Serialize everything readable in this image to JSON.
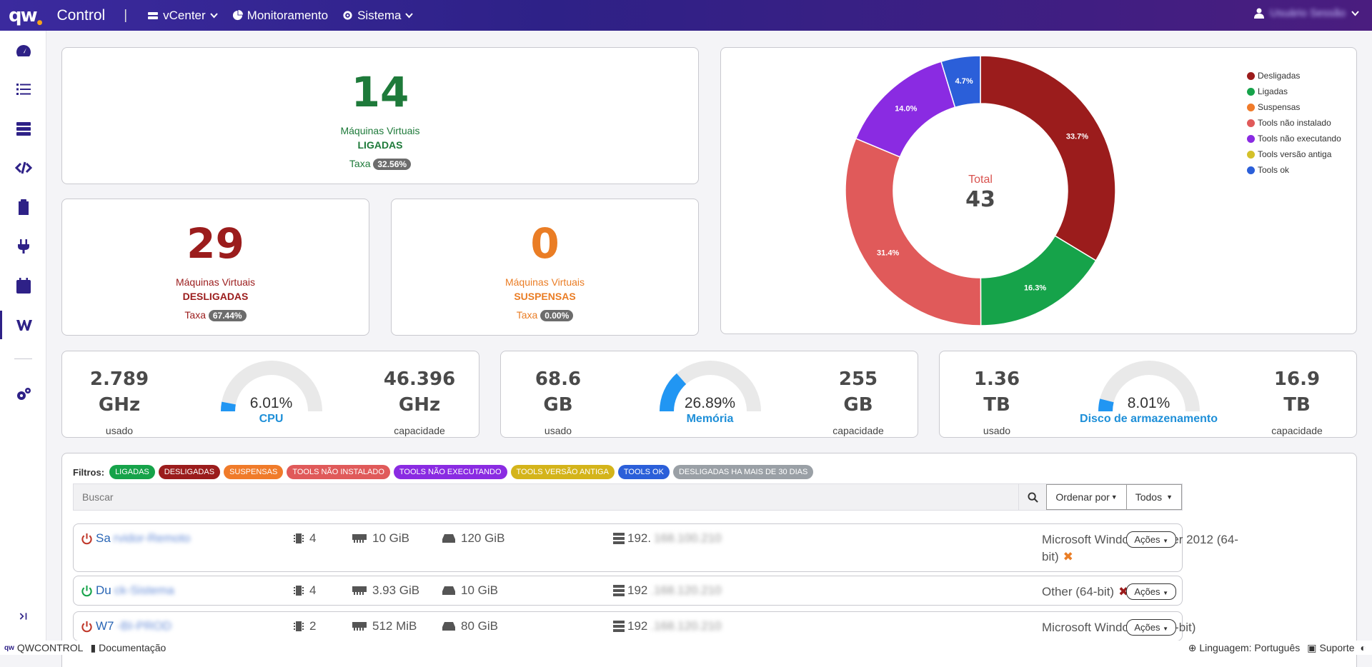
{
  "header": {
    "app_title": "Control",
    "vcenter": "vCenter",
    "monitoramento": "Monitoramento",
    "sistema": "Sistema",
    "user": "Usuário Sessão"
  },
  "stats": {
    "ligadas": {
      "value": "14",
      "label1": "Máquinas Virtuais",
      "label2": "LIGADAS",
      "taxa_label": "Taxa",
      "taxa": "32.56%",
      "color": "#1e7a3a"
    },
    "desligadas": {
      "value": "29",
      "label1": "Máquinas Virtuais",
      "label2": "DESLIGADAS",
      "taxa_label": "Taxa",
      "taxa": "67.44%",
      "color": "#9b1c1c"
    },
    "suspensas": {
      "value": "0",
      "label1": "Máquinas Virtuais",
      "label2": "SUSPENSAS",
      "taxa_label": "Taxa",
      "taxa": "0.00%",
      "color": "#ea7d25"
    }
  },
  "chart_data": {
    "type": "pie",
    "center_label": "Total",
    "center_value": "43",
    "slices": [
      {
        "name": "Desligadas",
        "value": 33.7,
        "label": "33.7%",
        "color": "#9b1c1c"
      },
      {
        "name": "Ligadas",
        "value": 16.3,
        "label": "16.3%",
        "color": "#16a34a"
      },
      {
        "name": "Tools não instalado",
        "value": 31.4,
        "label": "31.4%",
        "color": "#e05a5a"
      },
      {
        "name": "Tools não executando",
        "value": 14.0,
        "label": "14.0%",
        "color": "#8a2be2"
      },
      {
        "name": "Tools ok",
        "value": 4.7,
        "label": "4.7%",
        "color": "#2b5fd9"
      }
    ],
    "legend": [
      {
        "name": "Desligadas",
        "color": "#9b1c1c"
      },
      {
        "name": "Ligadas",
        "color": "#16a34a"
      },
      {
        "name": "Suspensas",
        "color": "#f07b2a"
      },
      {
        "name": "Tools não instalado",
        "color": "#e05a5a"
      },
      {
        "name": "Tools não executando",
        "color": "#8a2be2"
      },
      {
        "name": "Tools versão antiga",
        "color": "#d4c12a"
      },
      {
        "name": "Tools ok",
        "color": "#2b5fd9"
      }
    ],
    "legend_position": "top-right"
  },
  "gauges": [
    {
      "used_num": "2.789",
      "used_unit": "GHz",
      "used_label": "usado",
      "pct": "6.01%",
      "pct_value": 6.01,
      "name": "CPU",
      "cap_num": "46.396",
      "cap_unit": "GHz",
      "cap_label": "capacidade"
    },
    {
      "used_num": "68.6",
      "used_unit": "GB",
      "used_label": "usado",
      "pct": "26.89%",
      "pct_value": 26.89,
      "name": "Memória",
      "cap_num": "255",
      "cap_unit": "GB",
      "cap_label": "capacidade"
    },
    {
      "used_num": "1.36",
      "used_unit": "TB",
      "used_label": "usado",
      "pct": "8.01%",
      "pct_value": 8.01,
      "name": "Disco de armazenamento",
      "cap_num": "16.9",
      "cap_unit": "TB",
      "cap_label": "capacidade"
    }
  ],
  "filters": {
    "label": "Filtros:",
    "items": [
      {
        "label": "Ligadas",
        "color": "#16a34a"
      },
      {
        "label": "Desligadas",
        "color": "#9b1c1c"
      },
      {
        "label": "Suspensas",
        "color": "#f07b2a"
      },
      {
        "label": "Tools não instalado",
        "color": "#e05a5a"
      },
      {
        "label": "Tools não executando",
        "color": "#8a2be2"
      },
      {
        "label": "Tools versão antiga",
        "color": "#d4b41a"
      },
      {
        "label": "Tools ok",
        "color": "#2b5fd9"
      },
      {
        "label": "Desligadas ha mais de 30 dias",
        "color": "#9aa0a6"
      }
    ]
  },
  "search": {
    "placeholder": "Buscar",
    "order_label": "Ordenar por",
    "all_label": "Todos"
  },
  "vms": [
    {
      "name_prefix": "Sa",
      "name_rest": "rvidor-Remoto",
      "status": "off",
      "cpus": "4",
      "ram": "10 GiB",
      "disk": "120 GiB",
      "ip_prefix": "192.",
      "ip_rest": "168.100.210",
      "os": "Microsoft Windows Server 2012 (64-bit)",
      "tools": "warn",
      "acoes": "Ações"
    },
    {
      "name_prefix": "Du",
      "name_rest": "ck-Sistema",
      "status": "on",
      "cpus": "4",
      "ram": "3.93 GiB",
      "disk": "10 GiB",
      "ip_prefix": "192",
      "ip_rest": ".168.120.210",
      "os": "Other (64-bit)",
      "tools": "error",
      "acoes": "Ações"
    },
    {
      "name_prefix": "W7",
      "name_rest": "-BI-PROD",
      "status": "off",
      "cpus": "2",
      "ram": "512 MiB",
      "disk": "80 GiB",
      "ip_prefix": "192",
      "ip_rest": ".168.120.210",
      "os": "Microsoft Windows 7 (64-bit)",
      "tools": "none",
      "acoes": "Ações"
    }
  ],
  "footer": {
    "brand": "QWCONTROL",
    "docs": "Documentação",
    "lang": "Linguagem: Português",
    "support": "Suporte"
  }
}
